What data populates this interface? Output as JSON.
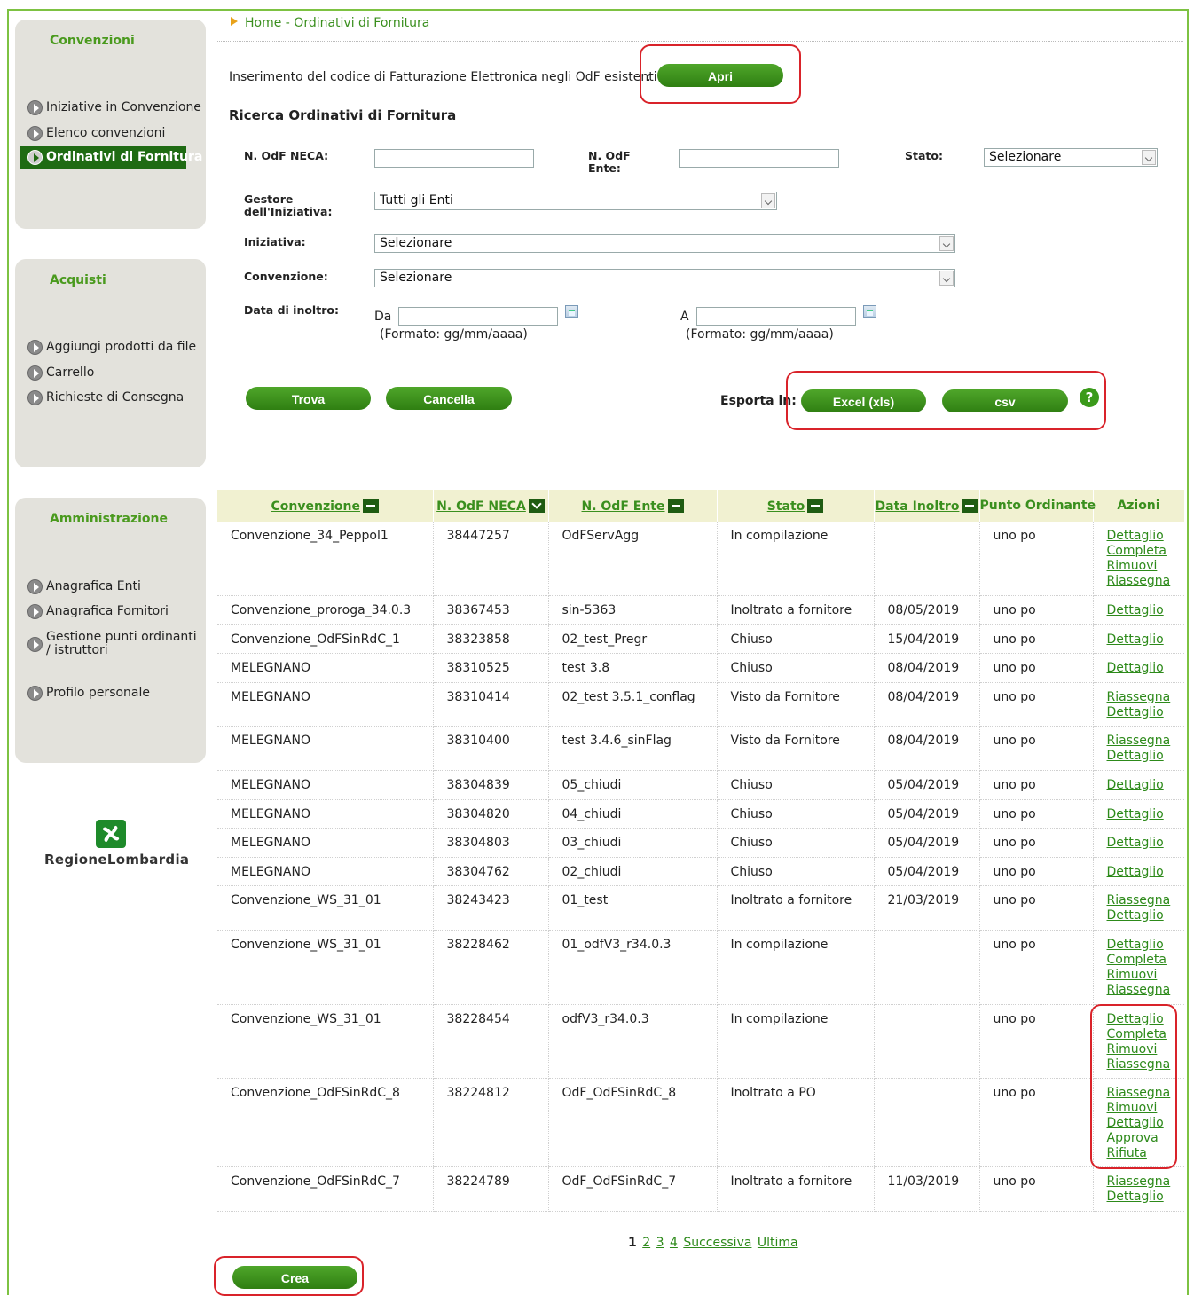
{
  "breadcrumb": "Home - Ordinativi di Fornitura",
  "sidebar": {
    "convenzioni": {
      "title": "Convenzioni",
      "items": [
        "Iniziative in Convenzione",
        "Elenco convenzioni",
        "Ordinativi di Fornitura"
      ],
      "active": "Ordinativi di Fornitura"
    },
    "acquisti": {
      "title": "Acquisti",
      "items": [
        "Aggiungi prodotti da file",
        "Carrello",
        "Richieste di Consegna"
      ]
    },
    "amministrazione": {
      "title": "Amministrazione",
      "items": [
        "Anagrafica Enti",
        "Anagrafica Fornitori",
        "Gestione punti ordinanti / istruttori",
        "Profilo personale"
      ]
    }
  },
  "logo_text": "RegioneLombardia",
  "fatturazione": {
    "text": "Inserimento del codice di Fatturazione Elettronica negli OdF esistenti",
    "colon": ":",
    "button": "Apri"
  },
  "search": {
    "title": "Ricerca Ordinativi di Fornitura",
    "odf_neca_label": "N. OdF NECA:",
    "odf_neca_value": "",
    "odf_ente_label": "N. OdF Ente:",
    "odf_ente_value": "",
    "stato_label": "Stato:",
    "stato_value": "Selezionare",
    "gestore_label": "Gestore dell'Iniziativa:",
    "gestore_value": "Tutti gli Enti",
    "iniziativa_label": "Iniziativa:",
    "iniziativa_value": "Selezionare",
    "convenzione_label": "Convenzione:",
    "convenzione_value": "Selezionare",
    "data_label": "Data di inoltro:",
    "da_label": "Da",
    "a_label": "A",
    "formato_hint": "(Formato: gg/mm/aaaa)",
    "trova_button": "Trova",
    "cancella_button": "Cancella",
    "esporta_label": "Esporta in:",
    "excel_button": "Excel (xls)",
    "csv_button": "csv",
    "help_icon_text": "?"
  },
  "table": {
    "headers": [
      "Convenzione",
      "N. OdF NECA",
      "N. OdF Ente",
      "Stato",
      "Data Inoltro",
      "Punto Ordinante",
      "Azioni"
    ],
    "rows": [
      {
        "conv": "Convenzione_34_Peppol1",
        "neca": "38447257",
        "ente": "OdFServAgg",
        "stato": "In compilazione",
        "data": "",
        "po": "uno po",
        "azioni": [
          "Dettaglio",
          "Completa",
          "Rimuovi",
          "Riassegna"
        ]
      },
      {
        "conv": "Convenzione_proroga_34.0.3",
        "neca": "38367453",
        "ente": "sin-5363",
        "stato": "Inoltrato a fornitore",
        "data": "08/05/2019",
        "po": "uno po",
        "azioni": [
          "Dettaglio"
        ]
      },
      {
        "conv": "Convenzione_OdFSinRdC_1",
        "neca": "38323858",
        "ente": "02_test_Pregr",
        "stato": "Chiuso",
        "data": "15/04/2019",
        "po": "uno po",
        "azioni": [
          "Dettaglio"
        ]
      },
      {
        "conv": "MELEGNANO",
        "neca": "38310525",
        "ente": "test 3.8",
        "stato": "Chiuso",
        "data": "08/04/2019",
        "po": "uno po",
        "azioni": [
          "Dettaglio"
        ]
      },
      {
        "conv": "MELEGNANO",
        "neca": "38310414",
        "ente": "02_test 3.5.1_conflag",
        "stato": "Visto da Fornitore",
        "data": "08/04/2019",
        "po": "uno po",
        "azioni": [
          "Riassegna",
          "Dettaglio"
        ]
      },
      {
        "conv": "MELEGNANO",
        "neca": "38310400",
        "ente": "test 3.4.6_sinFlag",
        "stato": "Visto da Fornitore",
        "data": "08/04/2019",
        "po": "uno po",
        "azioni": [
          "Riassegna",
          "Dettaglio"
        ]
      },
      {
        "conv": "MELEGNANO",
        "neca": "38304839",
        "ente": "05_chiudi",
        "stato": "Chiuso",
        "data": "05/04/2019",
        "po": "uno po",
        "azioni": [
          "Dettaglio"
        ]
      },
      {
        "conv": "MELEGNANO",
        "neca": "38304820",
        "ente": "04_chiudi",
        "stato": "Chiuso",
        "data": "05/04/2019",
        "po": "uno po",
        "azioni": [
          "Dettaglio"
        ]
      },
      {
        "conv": "MELEGNANO",
        "neca": "38304803",
        "ente": "03_chiudi",
        "stato": "Chiuso",
        "data": "05/04/2019",
        "po": "uno po",
        "azioni": [
          "Dettaglio"
        ]
      },
      {
        "conv": "MELEGNANO",
        "neca": "38304762",
        "ente": "02_chiudi",
        "stato": "Chiuso",
        "data": "05/04/2019",
        "po": "uno po",
        "azioni": [
          "Dettaglio"
        ]
      },
      {
        "conv": "Convenzione_WS_31_01",
        "neca": "38243423",
        "ente": "01_test",
        "stato": "Inoltrato a fornitore",
        "data": "21/03/2019",
        "po": "uno po",
        "azioni": [
          "Riassegna",
          "Dettaglio"
        ]
      },
      {
        "conv": "Convenzione_WS_31_01",
        "neca": "38228462",
        "ente": "01_odfV3_r34.0.3",
        "stato": "In compilazione",
        "data": "",
        "po": "uno po",
        "azioni": [
          "Dettaglio",
          "Completa",
          "Rimuovi",
          "Riassegna"
        ]
      },
      {
        "conv": "Convenzione_WS_31_01",
        "neca": "38228454",
        "ente": "odfV3_r34.0.3",
        "stato": "In compilazione",
        "data": "",
        "po": "uno po",
        "azioni": [
          "Dettaglio",
          "Completa",
          "Rimuovi",
          "Riassegna"
        ]
      },
      {
        "conv": "Convenzione_OdFSinRdC_8",
        "neca": "38224812",
        "ente": "OdF_OdFSinRdC_8",
        "stato": "Inoltrato a PO",
        "data": "",
        "po": "uno po",
        "azioni": [
          "Riassegna",
          "Rimuovi",
          "Dettaglio",
          "Approva",
          "Rifiuta"
        ]
      },
      {
        "conv": "Convenzione_OdFSinRdC_7",
        "neca": "38224789",
        "ente": "OdF_OdFSinRdC_7",
        "stato": "Inoltrato a fornitore",
        "data": "11/03/2019",
        "po": "uno po",
        "azioni": [
          "Riassegna",
          "Dettaglio"
        ]
      }
    ]
  },
  "pagination": {
    "current": "1",
    "pages": [
      "2",
      "3",
      "4"
    ],
    "next": "Successiva",
    "last": "Ultima"
  },
  "crea_button": "Crea",
  "colors": {
    "accent_green": "#3a8f1e",
    "dark_green": "#1f6b13",
    "highlight_red": "#d9232a",
    "header_bg": "#f1f1d1",
    "panel_bg": "#e3e2dc"
  },
  "icons": [
    "play-bullet-icon",
    "calendar-icon",
    "help-icon",
    "sort-icon",
    "regione-lombardia-logo"
  ]
}
